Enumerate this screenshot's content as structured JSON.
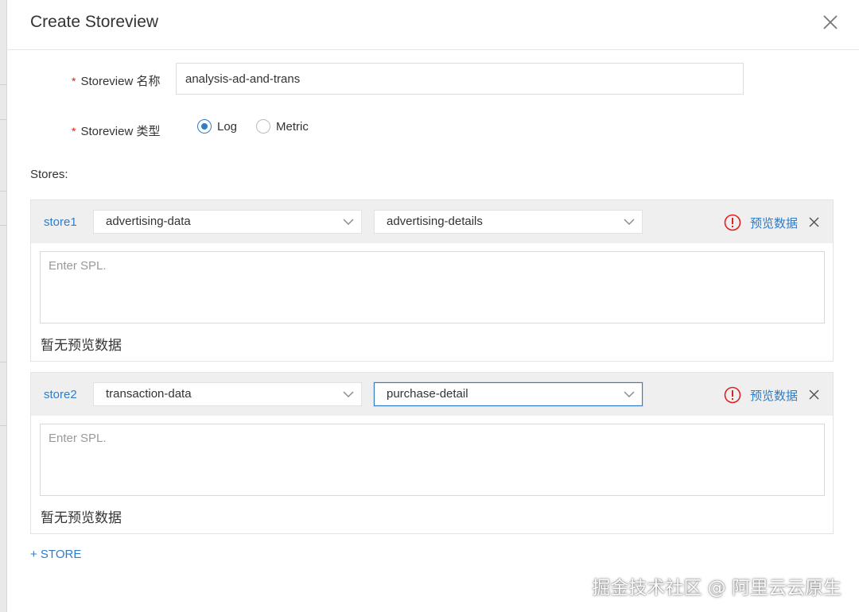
{
  "dialog": {
    "title": "Create Storeview"
  },
  "form": {
    "name_label": "Storeview 名称",
    "name_value": "analysis-ad-and-trans",
    "type_label": "Storeview 类型",
    "type_options": [
      "Log",
      "Metric"
    ],
    "type_selected": "Log",
    "stores_label": "Stores:"
  },
  "stores": [
    {
      "name": "store1",
      "project": "advertising-data",
      "logstore": "advertising-details",
      "spl_placeholder": "Enter SPL.",
      "preview_label": "预览数据",
      "no_data": "暂无预览数据"
    },
    {
      "name": "store2",
      "project": "transaction-data",
      "logstore": "purchase-detail",
      "spl_placeholder": "Enter SPL.",
      "preview_label": "预览数据",
      "no_data": "暂无预览数据"
    }
  ],
  "add_store_label": "+ STORE",
  "watermark": "掘金技术社区 @ 阿里云云原生",
  "colors": {
    "accent": "#2f7cc8",
    "required": "#e02020",
    "warning": "#e02020"
  }
}
